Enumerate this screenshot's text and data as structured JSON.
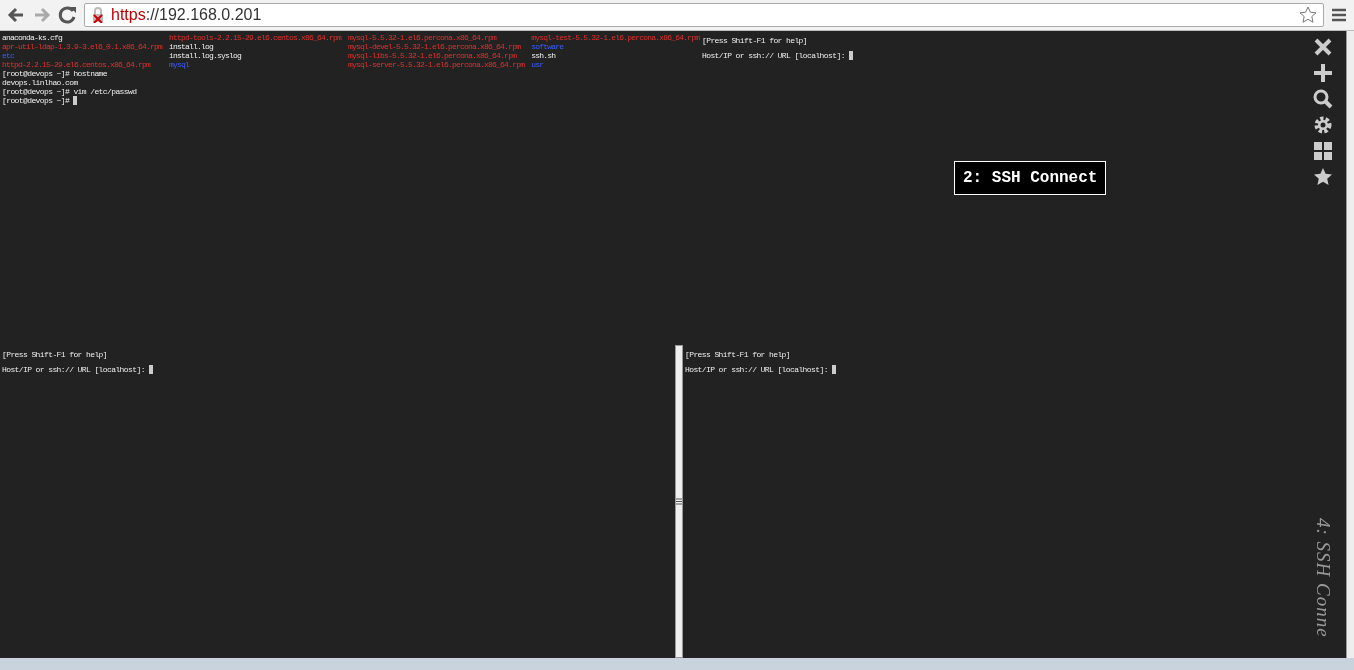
{
  "browser": {
    "url_scheme": "https",
    "url_rest": "://192.168.0.201"
  },
  "panes": [
    {
      "kind": "listing",
      "ls_rows": [
        [
          {
            "text": "anaconda-ks.cfg",
            "kind": "file"
          },
          {
            "text": "httpd-tools-2.2.15-29.el6.centos.x86_64.rpm",
            "kind": "archive"
          },
          {
            "text": "mysql-5.5.32-1.el6.percona.x86_64.rpm",
            "kind": "archive"
          },
          {
            "text": "mysql-test-5.5.32-1.el6.percona.x86_64.rpm",
            "kind": "archive"
          }
        ],
        [
          {
            "text": "apr-util-ldap-1.3.9-3.el6_0.1.x86_64.rpm",
            "kind": "archive"
          },
          {
            "text": "install.log",
            "kind": "file"
          },
          {
            "text": "mysql-devel-5.5.32-1.el6.percona.x86_64.rpm",
            "kind": "archive"
          },
          {
            "text": "software",
            "kind": "dir"
          }
        ],
        [
          {
            "text": "etc",
            "kind": "dir"
          },
          {
            "text": "install.log.syslog",
            "kind": "file"
          },
          {
            "text": "mysql-libs-5.5.32-1.el6.percona.x86_64.rpm",
            "kind": "archive"
          },
          {
            "text": "ssh.sh",
            "kind": "file"
          }
        ],
        [
          {
            "text": "httpd-2.2.15-29.el6.centos.x86_64.rpm",
            "kind": "archive"
          },
          {
            "text": "mysql",
            "kind": "dir"
          },
          {
            "text": "mysql-server-5.5.32-1.el6.percona.x86_64.rpm",
            "kind": "archive"
          },
          {
            "text": "usr",
            "kind": "dir"
          }
        ]
      ],
      "lines": [
        "[root@devops ~]# hostname",
        "devops.linlhao.com",
        "[root@devops ~]# vim /etc/passwd",
        "[root@devops ~]# "
      ]
    },
    {
      "kind": "prompt",
      "help": "[Press Shift-F1 for help]",
      "prompt": "Host/IP or ssh:// URL [localhost]: "
    },
    {
      "kind": "prompt",
      "help": "[Press Shift-F1 for help]",
      "prompt": "Host/IP or ssh:// URL [localhost]: "
    },
    {
      "kind": "prompt",
      "help": "[Press Shift-F1 for help]",
      "prompt": "Host/IP or ssh:// URL [localhost]: "
    }
  ],
  "popup_label": "2: SSH Connect",
  "side_label": "4: SSH Conne"
}
